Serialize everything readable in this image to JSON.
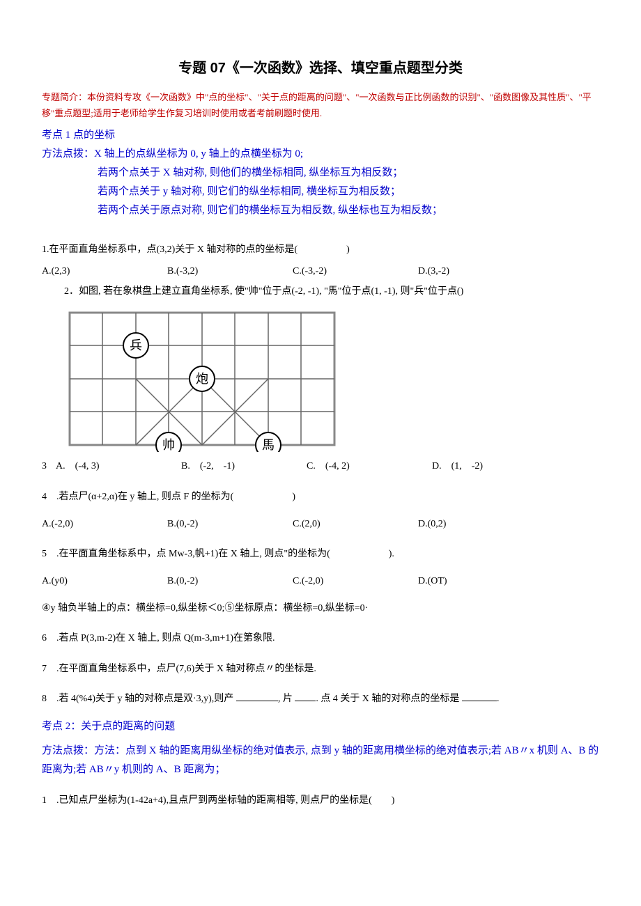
{
  "title": "专题 07《一次函数》选择、填空重点题型分类",
  "intro": "专题简介：本份资料专攻《一次函数》中\"点的坐标\"、\"关于点的距离的问题\"、\"一次函数与正比例函数的识别\"、\"函数图像及其性质\"、\"平移\"重点题型;适用于老师给学生作复习培训时使用或者考前刷题时使用.",
  "kd1": "考点 1 点的坐标",
  "ff1_l1": "方法点拨：X 轴上的点纵坐标为 0, y 轴上的点横坐标为 0;",
  "ff1_l2": "若两个点关于 X 轴对称, 则他们的横坐标相同, 纵坐标互为相反数；",
  "ff1_l3": "若两个点关于 y 轴对称, 则它们的纵坐标相同, 横坐标互为相反数；",
  "ff1_l4": "若两个点关于原点对称, 则它们的横坐标互为相反数, 纵坐标也互为相反数；",
  "q1": "1.在平面直角坐标系中，点(3,2)关于 X 轴对称的点的坐标是(     )",
  "q1a": "A.(2,3)",
  "q1b": "B.(-3,2)",
  "q1c": "C.(-3,-2)",
  "q1d": "D.(3,-2)",
  "q2": "2．如图, 若在象棋盘上建立直角坐标系, 使\"帅\"位于点(-2, -1), \"馬\"位于点(1, -1), 则\"兵\"位于点()",
  "q3lead": "3",
  "q3a": "A. (-4, 3)",
  "q3b": "B. (-2, -1)",
  "q3c": "C. (-4, 2)",
  "q3d": "D. (1, -2)",
  "q4": "4 .若点尸(α+2,α)在 y 轴上, 则点 F 的坐标为(      )",
  "q4a": "A.(-2,0)",
  "q4b": "B.(0,-2)",
  "q4c": "C.(2,0)",
  "q4d": "D.(0,2)",
  "q5": "5 .在平面直角坐标系中，点 Mw-3,帆+1)在 X 轴上, 则点\"的坐标为(      ).",
  "q5a": "A.(y0)",
  "q5b": "B.(0,-2)",
  "q5c": "C.(-2,0)",
  "q5d": "D.(OT)",
  "note45": "④y 轴负半轴上的点：横坐标=0,纵坐标＜0;⑤坐标原点：横坐标=0,纵坐标=0·",
  "q6": "6 .若点 P(3,m-2)在 X 轴上, 则点 Q(m-3,m+1)在第象限.",
  "q7": "7 .在平面直角坐标系中，点尸(7,6)关于 X 轴对称点〃的坐标是.",
  "q8_a": "8 .若 4(%4)关于 y 轴的对称点是双·3,y),则产 ",
  "q8_b": ", 片 ",
  "q8_c": ". 点 4 关于 X 轴的对称点的坐标是 ",
  "q8_d": ".",
  "kd2": "考点 2：关于点的距离的问题",
  "ff2_l1": "方法点拨：方法：点到 X 轴的距离用纵坐标的绝对值表示, 点到 y 轴的距离用横坐标的绝对值表示;若 AB〃x 机则 A、B 的距离为;若 AB〃y 机则的 A、B 距离为；",
  "q21": "1 .已知点尸坐标为(1-42a+4),且点尸到两坐标轴的距离相等, 则点尸的坐标是(  )",
  "chess": {
    "pieces": {
      "bing": "兵",
      "pao": "炮",
      "shuai": "帅",
      "ma": "馬"
    }
  }
}
